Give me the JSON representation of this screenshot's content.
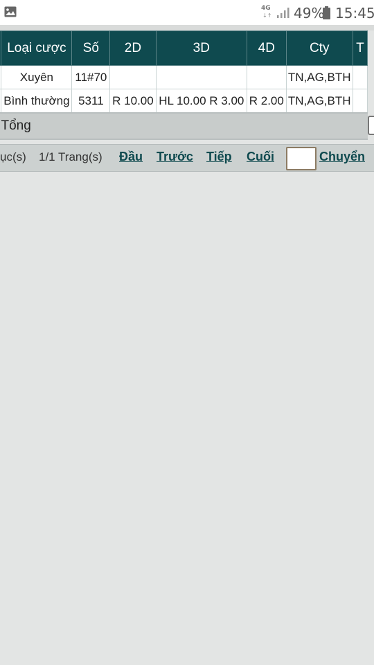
{
  "status_bar": {
    "network": "4G",
    "network_arrows": "↓↑",
    "battery": "49%",
    "time": "15:45"
  },
  "table": {
    "headers": [
      "Loại cược",
      "Số",
      "2D",
      "3D",
      "4D",
      "Cty",
      "T"
    ],
    "rows": [
      [
        "Xuyên",
        "11#70",
        "",
        "",
        "",
        "TN,AG,BTH"
      ],
      [
        "Bình thường",
        "5311",
        "R 10.00",
        "HL 10.00 R 3.00",
        "R 2.00",
        "TN,AG,BTH"
      ]
    ],
    "total_label": "Tổng"
  },
  "pager": {
    "records_text": "ục(s)",
    "pages_text": "1/1 Trang(s)",
    "first": "Đầu",
    "prev": "Trước",
    "next": "Tiếp",
    "last": "Cuối",
    "go": "Chuyển",
    "page_input_value": ""
  }
}
